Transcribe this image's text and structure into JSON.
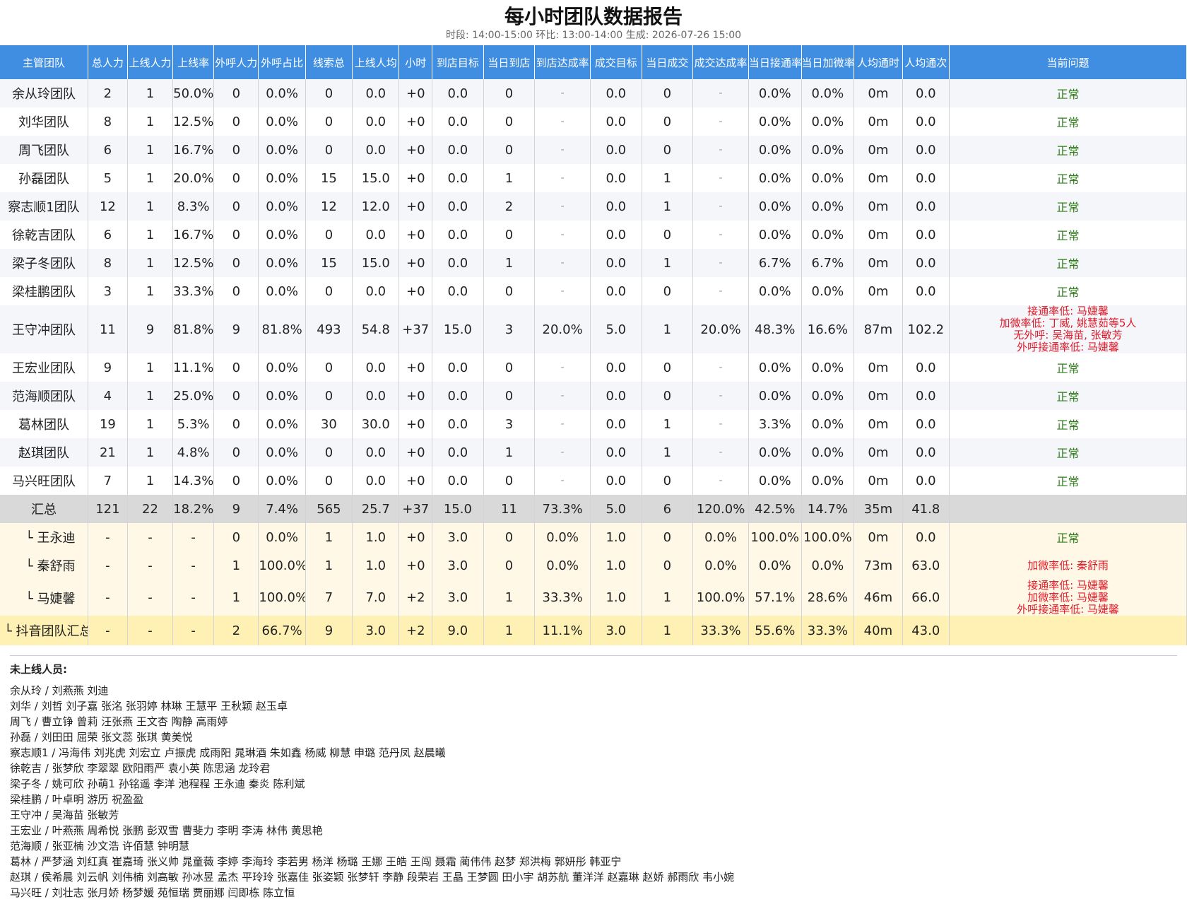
{
  "title": "每小时团队数据报告",
  "subtitle": "时段: 14:00-15:00  环比: 13:00-14:00  生成: 2026-07-26 15:00",
  "headers": [
    "主管团队",
    "总人力",
    "上线人力",
    "上线率",
    "外呼人力",
    "外呼占比",
    "线索总",
    "上线人均",
    "小时",
    "到店目标",
    "当日到店",
    "到店达成率",
    "成交目标",
    "当日成交",
    "成交达成率",
    "当日接通率",
    "当日加微率",
    "人均通时",
    "人均通次",
    "当前问题"
  ],
  "teams": [
    {
      "cells": [
        "余从玲团队",
        "2",
        "1",
        "50.0%",
        "0",
        "0.0%",
        "0",
        "0.0",
        "+0",
        "0.0",
        "0",
        "-",
        "0.0",
        "0",
        "-",
        "0.0%",
        "0.0%",
        "0m",
        "0.0"
      ],
      "status": "ok",
      "issues": [
        "正常"
      ]
    },
    {
      "cells": [
        "刘华团队",
        "8",
        "1",
        "12.5%",
        "0",
        "0.0%",
        "0",
        "0.0",
        "+0",
        "0.0",
        "0",
        "-",
        "0.0",
        "0",
        "-",
        "0.0%",
        "0.0%",
        "0m",
        "0.0"
      ],
      "status": "ok",
      "issues": [
        "正常"
      ]
    },
    {
      "cells": [
        "周飞团队",
        "6",
        "1",
        "16.7%",
        "0",
        "0.0%",
        "0",
        "0.0",
        "+0",
        "0.0",
        "0",
        "-",
        "0.0",
        "0",
        "-",
        "0.0%",
        "0.0%",
        "0m",
        "0.0"
      ],
      "status": "ok",
      "issues": [
        "正常"
      ]
    },
    {
      "cells": [
        "孙磊团队",
        "5",
        "1",
        "20.0%",
        "0",
        "0.0%",
        "15",
        "15.0",
        "+0",
        "0.0",
        "1",
        "-",
        "0.0",
        "1",
        "-",
        "0.0%",
        "0.0%",
        "0m",
        "0.0"
      ],
      "status": "ok",
      "issues": [
        "正常"
      ]
    },
    {
      "cells": [
        "察志顺1团队",
        "12",
        "1",
        "8.3%",
        "0",
        "0.0%",
        "12",
        "12.0",
        "+0",
        "0.0",
        "2",
        "-",
        "0.0",
        "1",
        "-",
        "0.0%",
        "0.0%",
        "0m",
        "0.0"
      ],
      "status": "ok",
      "issues": [
        "正常"
      ]
    },
    {
      "cells": [
        "徐乾吉团队",
        "6",
        "1",
        "16.7%",
        "0",
        "0.0%",
        "0",
        "0.0",
        "+0",
        "0.0",
        "0",
        "-",
        "0.0",
        "0",
        "-",
        "0.0%",
        "0.0%",
        "0m",
        "0.0"
      ],
      "status": "ok",
      "issues": [
        "正常"
      ]
    },
    {
      "cells": [
        "梁子冬团队",
        "8",
        "1",
        "12.5%",
        "0",
        "0.0%",
        "15",
        "15.0",
        "+0",
        "0.0",
        "1",
        "-",
        "0.0",
        "1",
        "-",
        "6.7%",
        "6.7%",
        "0m",
        "0.0"
      ],
      "status": "ok",
      "issues": [
        "正常"
      ]
    },
    {
      "cells": [
        "梁桂鹏团队",
        "3",
        "1",
        "33.3%",
        "0",
        "0.0%",
        "0",
        "0.0",
        "+0",
        "0.0",
        "0",
        "-",
        "0.0",
        "0",
        "-",
        "0.0%",
        "0.0%",
        "0m",
        "0.0"
      ],
      "status": "ok",
      "issues": [
        "正常"
      ]
    },
    {
      "cells": [
        "王守冲团队",
        "11",
        "9",
        "81.8%",
        "9",
        "81.8%",
        "493",
        "54.8",
        "+37",
        "15.0",
        "3",
        "20.0%",
        "5.0",
        "1",
        "20.0%",
        "48.3%",
        "16.6%",
        "87m",
        "102.2"
      ],
      "status": "bad",
      "issues": [
        "接通率低: 马婕馨",
        "加微率低: 丁威, 姚慧茹等5人",
        "无外呼: 吴海苗, 张敏芳",
        "外呼接通率低: 马婕馨"
      ]
    },
    {
      "cells": [
        "王宏业团队",
        "9",
        "1",
        "11.1%",
        "0",
        "0.0%",
        "0",
        "0.0",
        "+0",
        "0.0",
        "0",
        "-",
        "0.0",
        "0",
        "-",
        "0.0%",
        "0.0%",
        "0m",
        "0.0"
      ],
      "status": "ok",
      "issues": [
        "正常"
      ]
    },
    {
      "cells": [
        "范海顺团队",
        "4",
        "1",
        "25.0%",
        "0",
        "0.0%",
        "0",
        "0.0",
        "+0",
        "0.0",
        "0",
        "-",
        "0.0",
        "0",
        "-",
        "0.0%",
        "0.0%",
        "0m",
        "0.0"
      ],
      "status": "ok",
      "issues": [
        "正常"
      ]
    },
    {
      "cells": [
        "葛林团队",
        "19",
        "1",
        "5.3%",
        "0",
        "0.0%",
        "30",
        "30.0",
        "+0",
        "0.0",
        "3",
        "-",
        "0.0",
        "1",
        "-",
        "3.3%",
        "0.0%",
        "0m",
        "0.0"
      ],
      "status": "ok",
      "issues": [
        "正常"
      ]
    },
    {
      "cells": [
        "赵琪团队",
        "21",
        "1",
        "4.8%",
        "0",
        "0.0%",
        "0",
        "0.0",
        "+0",
        "0.0",
        "1",
        "-",
        "0.0",
        "1",
        "-",
        "0.0%",
        "0.0%",
        "0m",
        "0.0"
      ],
      "status": "ok",
      "issues": [
        "正常"
      ]
    },
    {
      "cells": [
        "马兴旺团队",
        "7",
        "1",
        "14.3%",
        "0",
        "0.0%",
        "0",
        "0.0",
        "+0",
        "0.0",
        "0",
        "-",
        "0.0",
        "0",
        "-",
        "0.0%",
        "0.0%",
        "0m",
        "0.0"
      ],
      "status": "ok",
      "issues": [
        "正常"
      ]
    }
  ],
  "total": {
    "cells": [
      "汇总",
      "121",
      "22",
      "18.2%",
      "9",
      "7.4%",
      "565",
      "25.7",
      "+37",
      "15.0",
      "11",
      "73.3%",
      "5.0",
      "6",
      "120.0%",
      "42.5%",
      "14.7%",
      "35m",
      "41.8"
    ]
  },
  "members": [
    {
      "cells": [
        "└ 王永迪",
        "-",
        "-",
        "-",
        "0",
        "0.0%",
        "1",
        "1.0",
        "+0",
        "3.0",
        "0",
        "0.0%",
        "1.0",
        "0",
        "0.0%",
        "100.0%",
        "100.0%",
        "0m",
        "0.0"
      ],
      "status": "ok",
      "issues": [
        "正常"
      ]
    },
    {
      "cells": [
        "└ 秦舒雨",
        "-",
        "-",
        "-",
        "1",
        "100.0%",
        "1",
        "1.0",
        "+0",
        "3.0",
        "0",
        "0.0%",
        "1.0",
        "0",
        "0.0%",
        "0.0%",
        "0.0%",
        "73m",
        "63.0"
      ],
      "status": "bad",
      "issues": [
        "加微率低: 秦舒雨"
      ]
    },
    {
      "cells": [
        "└ 马婕馨",
        "-",
        "-",
        "-",
        "1",
        "100.0%",
        "7",
        "7.0",
        "+2",
        "3.0",
        "1",
        "33.3%",
        "1.0",
        "1",
        "100.0%",
        "57.1%",
        "28.6%",
        "46m",
        "66.0"
      ],
      "status": "bad",
      "issues": [
        "接通率低: 马婕馨",
        "加微率低: 马婕馨",
        "外呼接通率低: 马婕馨"
      ]
    }
  ],
  "douyin_sum": {
    "cells": [
      "└ 抖音团队汇总",
      "-",
      "-",
      "-",
      "2",
      "66.7%",
      "9",
      "3.0",
      "+2",
      "9.0",
      "1",
      "11.1%",
      "3.0",
      "1",
      "33.3%",
      "55.6%",
      "33.3%",
      "40m",
      "43.0"
    ]
  },
  "not_online_title": "未上线人员:",
  "not_online": [
    "余从玲 / 刘燕燕 刘迪",
    "刘华 / 刘哲 刘子嘉 张洺 张羽婷 林琳 王慧平 王秋颖 赵玉卓",
    "周飞 / 曹立铮 曾莉 汪张燕 王文杏 陶静 高雨婷",
    "孙磊 / 刘田田 屈荣  张文蕊 张琪 黄美悦",
    "察志顺1 / 冯海伟 刘兆虎 刘宏立 卢振虎 成雨阳  晁琳酒 朱如鑫 杨威 柳慧 申璐 范丹凤 赵晨曦",
    "徐乾吉 / 张梦欣 李翠翠 欧阳雨严 袁小英 陈思涵 龙玲君",
    "梁子冬 / 姚可欣 孙萌1 孙铭遥 李洋 池程程 王永迪 秦炎 陈利斌",
    "梁桂鹏 / 叶卓明 游历 祝盈盈",
    "王守冲 / 吴海苗 张敏芳",
    "王宏业 / 叶燕燕 周希悦 张鹏 彭双雪 曹斐力 李明 李涛 林伟 黄思艳",
    "范海顺 / 张亚楠 沙文浩 许佰慧 钟明慧",
    "葛林 / 严梦涵 刘红真 崔嘉琦 张义帅 晁童薇 李婷 李海玲 李若男 杨洋 杨璐 王娜 王皓 王闯 聂霜 蔺伟伟 赵梦 郑洪梅 郭妍彤 韩亚宁",
    "赵琪 / 侯希晨 刘云帆 刘伟楠 刘高敏 孙冰昱 孟杰 平玲玲 张嘉佳 张姿颖 张梦轩 李静 段荣岩 王晶 王梦圆 田小宇 胡苏航 董洋洋 赵嘉琳 赵娇 郝雨欣 韦小婉",
    "马兴旺 / 刘壮志 张月娇 杨梦媛 苑恒瑞 贾丽娜 闫即栋 陈立恒"
  ]
}
